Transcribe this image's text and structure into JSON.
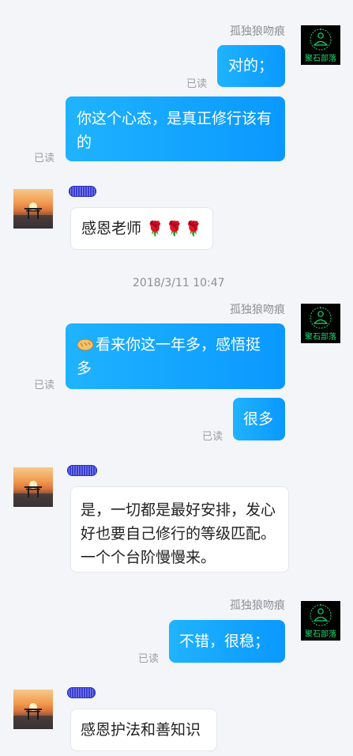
{
  "colors": {
    "background": "#f3f5f8",
    "bubble_me": "#0a98ff",
    "bubble_other": "#ffffff",
    "read_text": "#9aa0a6"
  },
  "me": {
    "name": "孤独狼吻痕",
    "avatar_seal_text": "聚石部落",
    "avatar_icon": "buddha-emblem-icon"
  },
  "messages": {
    "m1": {
      "text": "对的；",
      "read": "已读"
    },
    "m2": {
      "text": "你这个心态，是真正修行该有的",
      "read": "已读"
    },
    "m3": {
      "text": "感恩老师",
      "icons": "rose-icon rose-icon rose-icon"
    },
    "timestamp": "2018/3/11 10:47",
    "m4": {
      "text": "看来你这一年多，感悟挺多",
      "icon": "bread-icon",
      "read": "已读"
    },
    "m5": {
      "text": "很多",
      "read": "已读"
    },
    "m6": {
      "text": "是，一切都是最好安排，发心好也要自己修行的等级匹配。一个个台阶慢慢来。"
    },
    "m7": {
      "text": "不错，很稳；",
      "read": "已读"
    },
    "m8": {
      "text": "感恩护法和善知识"
    }
  }
}
